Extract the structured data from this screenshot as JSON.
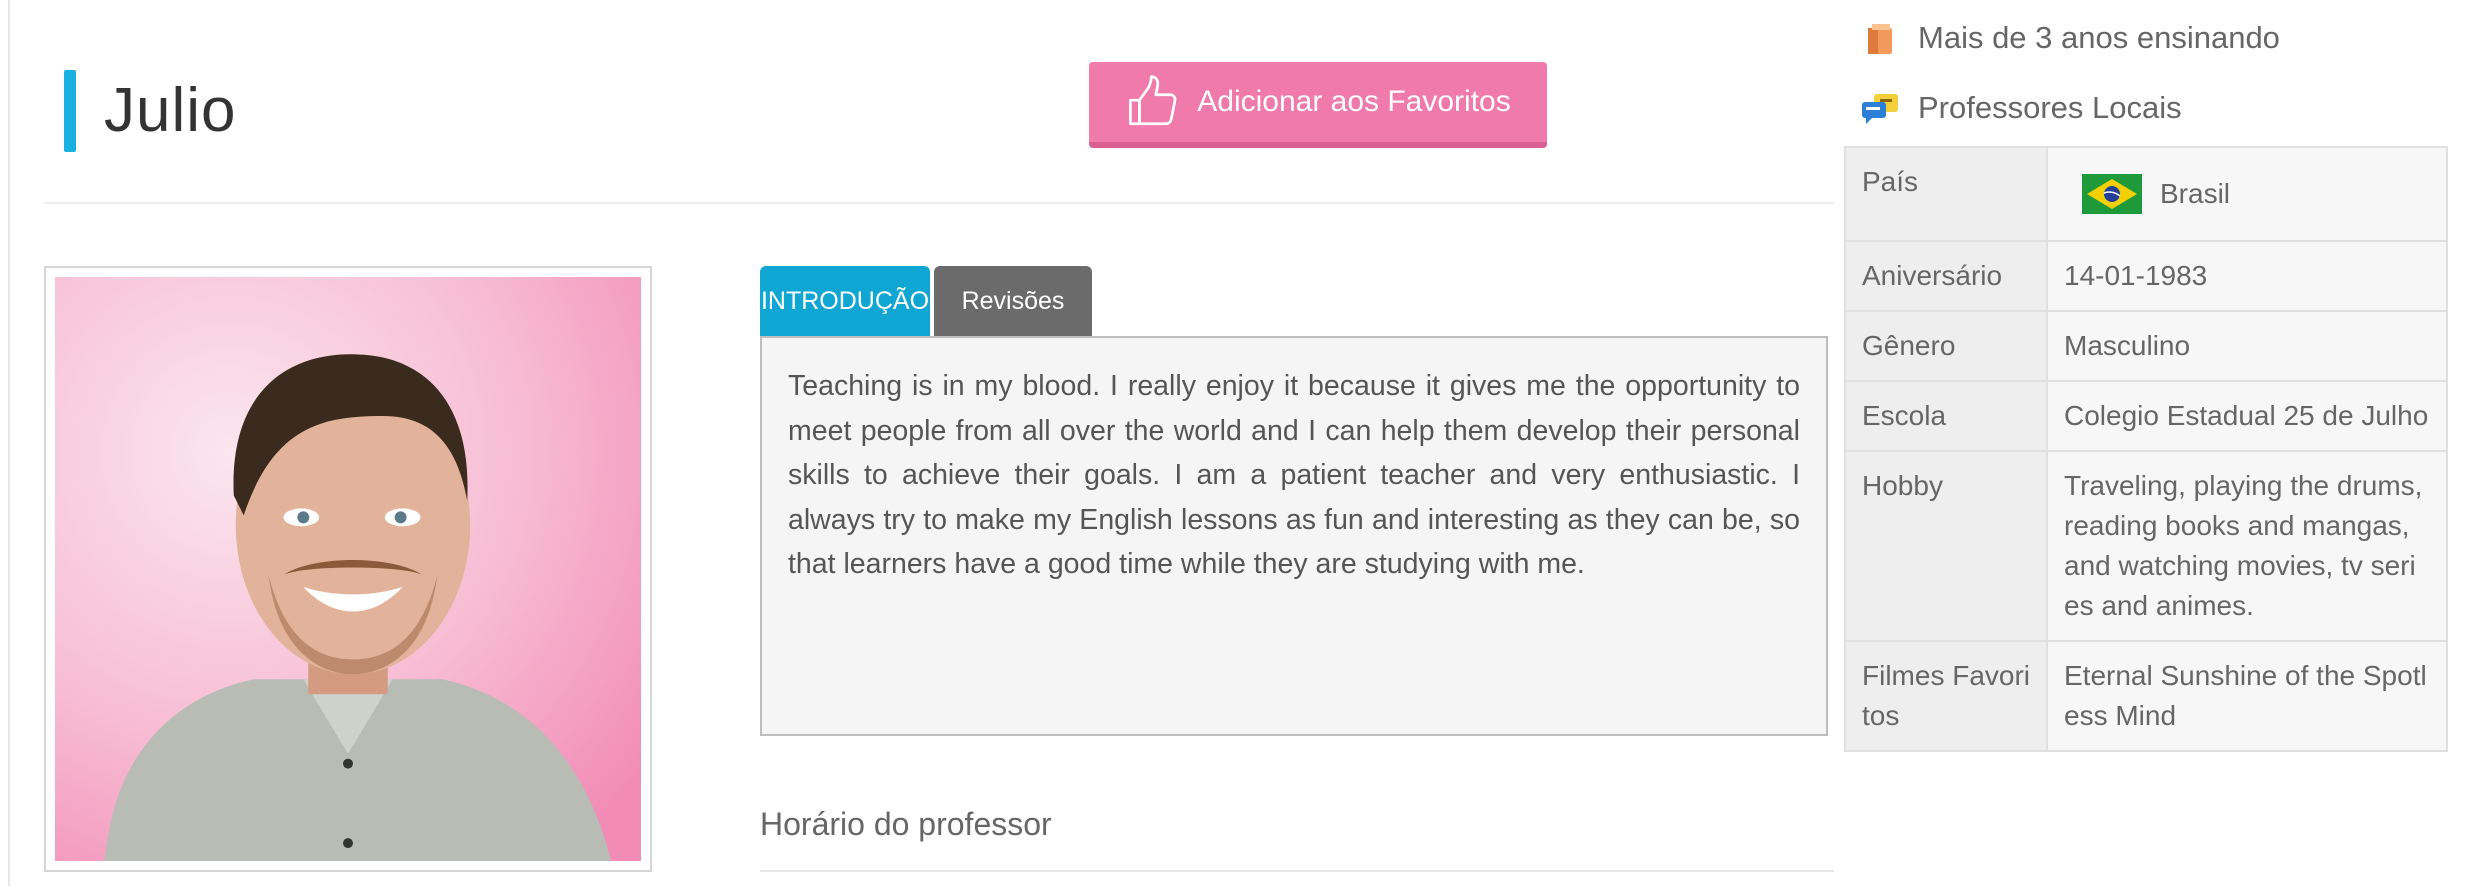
{
  "profile": {
    "name": "Julio",
    "favorite_button": "Adicionar aos Favoritos"
  },
  "tabs": [
    {
      "label": "INTRODUÇÃO",
      "active": true
    },
    {
      "label": "Revisões",
      "active": false
    }
  ],
  "intro": {
    "text": "Teaching is in my blood. I really enjoy it because it gives me the opportunity to meet people from all over the world and I can help them develop their personal skills to achieve their goals. I am a patient teacher and very enthusiastic. I always try to make my English lessons as fun and interesting as they can be, so that learners have a good time while they are studying with me."
  },
  "schedule": {
    "title": "Horário do professor"
  },
  "meta": [
    {
      "icon": "books-icon",
      "text": "Mais de 3 anos ensinando"
    },
    {
      "icon": "chat-bubbles-icon",
      "text": "Professores Locais"
    }
  ],
  "info_table": [
    {
      "label": "País",
      "value": "Brasil",
      "icon": "brazil-flag-icon"
    },
    {
      "label": "Aniversário",
      "value": "14-01-1983"
    },
    {
      "label": "Gênero",
      "value": "Masculino"
    },
    {
      "label": "Escola",
      "value": "Colegio Estadual 25 de Julho"
    },
    {
      "label": "Hobby",
      "value": "Traveling, playing the drums, reading books and mangas, and watching movies, tv series and animes."
    },
    {
      "label": "Filmes Favoritos",
      "value": "Eternal Sunshine of the Spotless Mind"
    }
  ],
  "colors": {
    "accent_blue": "#10a6d3",
    "favorite_pink": "#f07aab",
    "tab_inactive": "#6b6b6b"
  }
}
